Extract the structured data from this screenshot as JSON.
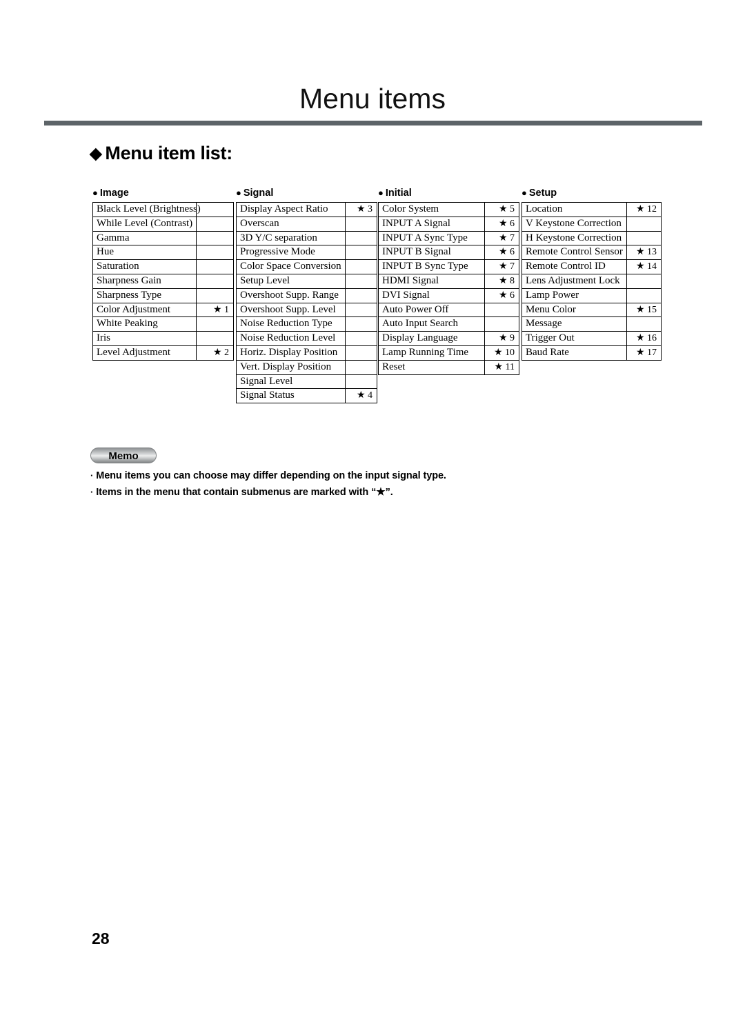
{
  "page": {
    "title": "Menu items",
    "section_heading": "Menu item list:",
    "section_heading_marker": "◆",
    "page_number": "28",
    "rule_color": "#5d6468"
  },
  "columns": [
    {
      "id": "image",
      "header": "Image",
      "bullet": "●",
      "rows": [
        {
          "label": "Black Level (Brightness)",
          "ref": ""
        },
        {
          "label": "While Level (Contrast)",
          "ref": ""
        },
        {
          "label": "Gamma",
          "ref": ""
        },
        {
          "label": "Hue",
          "ref": ""
        },
        {
          "label": "Saturation",
          "ref": ""
        },
        {
          "label": "Sharpness Gain",
          "ref": ""
        },
        {
          "label": "Sharpness Type",
          "ref": ""
        },
        {
          "label": "Color Adjustment",
          "ref": "★ 1"
        },
        {
          "label": "White Peaking",
          "ref": ""
        },
        {
          "label": "Iris",
          "ref": ""
        },
        {
          "label": "Level Adjustment",
          "ref": "★ 2"
        }
      ]
    },
    {
      "id": "signal",
      "header": "Signal",
      "bullet": "●",
      "rows": [
        {
          "label": "Display Aspect Ratio",
          "ref": "★ 3"
        },
        {
          "label": "Overscan",
          "ref": ""
        },
        {
          "label": "3D Y/C separation",
          "ref": ""
        },
        {
          "label": "Progressive Mode",
          "ref": ""
        },
        {
          "label": "Color Space Conversion",
          "ref": ""
        },
        {
          "label": "Setup Level",
          "ref": ""
        },
        {
          "label": "Overshoot Supp. Range",
          "ref": ""
        },
        {
          "label": "Overshoot Supp. Level",
          "ref": ""
        },
        {
          "label": "Noise Reduction Type",
          "ref": ""
        },
        {
          "label": "Noise Reduction Level",
          "ref": ""
        },
        {
          "label": "Horiz. Display Position",
          "ref": ""
        },
        {
          "label": "Vert. Display Position",
          "ref": ""
        },
        {
          "label": "Signal Level",
          "ref": ""
        },
        {
          "label": "Signal Status",
          "ref": "★ 4"
        }
      ]
    },
    {
      "id": "initial",
      "header": "Initial",
      "bullet": "●",
      "rows": [
        {
          "label": "Color System",
          "ref": "★ 5"
        },
        {
          "label": "INPUT A Signal",
          "ref": "★ 6"
        },
        {
          "label": "INPUT A Sync Type",
          "ref": "★ 7"
        },
        {
          "label": "INPUT B Signal",
          "ref": "★ 6"
        },
        {
          "label": "INPUT B Sync Type",
          "ref": "★ 7"
        },
        {
          "label": "HDMI Signal",
          "ref": "★ 8"
        },
        {
          "label": "DVI Signal",
          "ref": "★ 6"
        },
        {
          "label": "Auto Power Off",
          "ref": ""
        },
        {
          "label": "Auto Input Search",
          "ref": ""
        },
        {
          "label": "Display Language",
          "ref": "★ 9"
        },
        {
          "label": "Lamp Running Time",
          "ref": "★ 10"
        },
        {
          "label": "Reset",
          "ref": "★ 11"
        }
      ]
    },
    {
      "id": "setup",
      "header": "Setup",
      "bullet": "●",
      "rows": [
        {
          "label": "Location",
          "ref": "★ 12"
        },
        {
          "label": "V Keystone Correction",
          "ref": ""
        },
        {
          "label": "H Keystone Correction",
          "ref": ""
        },
        {
          "label": "Remote Control Sensor",
          "ref": "★ 13"
        },
        {
          "label": "Remote Control ID",
          "ref": "★ 14"
        },
        {
          "label": "Lens Adjustment Lock",
          "ref": ""
        },
        {
          "label": "Lamp Power",
          "ref": ""
        },
        {
          "label": "Menu Color",
          "ref": "★ 15"
        },
        {
          "label": "Message",
          "ref": ""
        },
        {
          "label": "Trigger Out",
          "ref": "★ 16"
        },
        {
          "label": "Baud Rate",
          "ref": "★ 17"
        }
      ]
    }
  ],
  "memo": {
    "pill_label": "Memo",
    "bullet": "·",
    "line_1": "Menu items you can choose may differ depending on the input signal type.",
    "line_2_prefix": "Items in the menu that contain submenus are marked with “",
    "line_2_star": "★",
    "line_2_suffix": "”."
  }
}
